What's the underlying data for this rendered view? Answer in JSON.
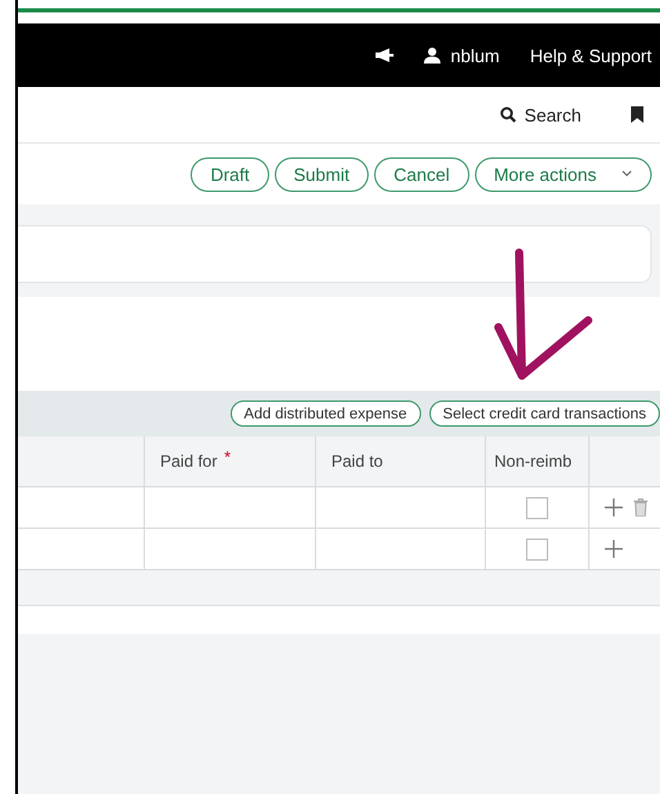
{
  "top_bar": {
    "username": "nblum",
    "help": "Help & Support"
  },
  "nav": {
    "search": "Search"
  },
  "actions": [
    "Draft",
    "Submit",
    "Cancel"
  ],
  "more_actions": "More actions",
  "toolbar": [
    "Add distributed expense",
    "Select credit card transactions"
  ],
  "table": {
    "columns": [
      {
        "label": "Paid for",
        "required_mark": "*"
      },
      {
        "label": "Paid to"
      },
      {
        "label": "Non-reimb"
      }
    ],
    "rows": [
      {
        "non_reimb": false,
        "deletable": true
      },
      {
        "non_reimb": false,
        "deletable": false
      }
    ]
  }
}
